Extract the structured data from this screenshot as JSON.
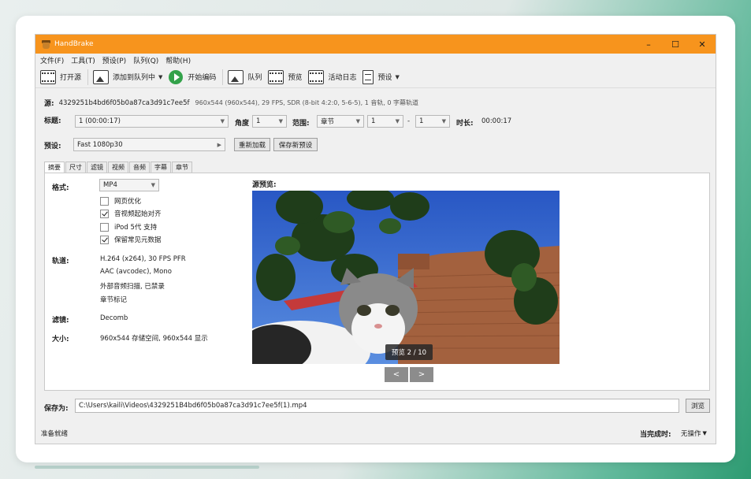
{
  "window": {
    "title": "HandBrake",
    "minimize": "–",
    "maximize": "☐",
    "close": "✕"
  },
  "menu": [
    "文件(F)",
    "工具(T)",
    "预设(P)",
    "队列(Q)",
    "帮助(H)"
  ],
  "toolbar": {
    "open_source": "打开源",
    "add_to_queue": "添加到队列中",
    "start_encode": "开始编码",
    "queue": "队列",
    "preview": "预览",
    "activity_log": "活动日志",
    "presets": "预设"
  },
  "source": {
    "label": "源:",
    "name": "4329251b4bd6f05b0a87ca3d91c7ee5f",
    "info": "960x544 (960x544), 29 FPS, SDR (8-bit 4:2:0, 5-6-5), 1 音轨, 0 字幕轨道"
  },
  "title_row": {
    "title_label": "标题:",
    "title_value": "1  (00:00:17)",
    "angle_label": "角度",
    "angle_value": "1",
    "range_label": "范围:",
    "range_type": "章节",
    "range_start": "1",
    "range_dash": "-",
    "range_end": "1",
    "duration_label": "时长:",
    "duration_value": "00:00:17"
  },
  "preset_row": {
    "label": "预设:",
    "value": "Fast 1080p30",
    "reload": "重新加载",
    "save_new": "保存新预设"
  },
  "tabs": [
    "摘要",
    "尺寸",
    "滤镜",
    "视频",
    "音频",
    "字幕",
    "章节"
  ],
  "summary": {
    "format_label": "格式:",
    "format_value": "MP4",
    "options": [
      {
        "label": "网页优化",
        "checked": false
      },
      {
        "label": "音视频起始对齐",
        "checked": true
      },
      {
        "label": "iPod 5代 支持",
        "checked": false
      },
      {
        "label": "保留常见元数据",
        "checked": true
      }
    ],
    "tracks_label": "轨道:",
    "tracks": [
      "H.264 (x264), 30 FPS PFR",
      "AAC (avcodec), Mono",
      "外部音频扫描, 已禁录",
      "章节标记"
    ],
    "filters_label": "滤镜:",
    "filters_value": "Decomb",
    "size_label": "大小:",
    "size_value": "960x544 存储空间, 960x544 显示"
  },
  "preview": {
    "label": "源预览:",
    "counter": "预览 2 / 10",
    "prev": "<",
    "next": ">"
  },
  "save": {
    "label": "保存为:",
    "path": "C:\\Users\\kaili\\Videos\\4329251B4bd6f05b0a87ca3d91c7ee5f(1).mp4",
    "browse": "浏览"
  },
  "status": {
    "left": "准备就绪",
    "when_done_label": "当完成时:",
    "when_done_value": "无操作"
  },
  "colors": {
    "titlebar": "#f7941d",
    "play": "#33a24a"
  }
}
